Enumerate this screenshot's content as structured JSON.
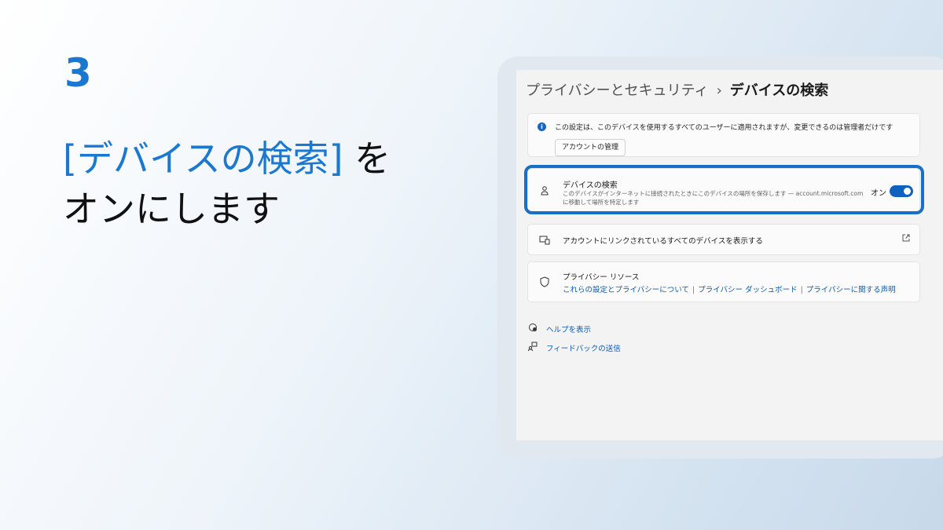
{
  "slide": {
    "step": "3",
    "headline_accent": "[デバイスの検索]",
    "headline_rest": " を",
    "headline_line2": "オンにします"
  },
  "settings": {
    "breadcrumb_parent": "プライバシーとセキュリティ",
    "breadcrumb_sep": "›",
    "breadcrumb_current": "デバイスの検索",
    "info_text": "この設定は、このデバイスを使用するすべてのユーザーに適用されますが、変更できるのは管理者だけです",
    "manage_account_label": "アカウントの管理",
    "find_device": {
      "title": "デバイスの検索",
      "description": "このデバイスがインターネットに接続されたときにこのデバイスの場所を保存します — account.microsoft.com に移動して場所を特定します",
      "toggle_label": "オン",
      "toggle_on": true
    },
    "linked_devices_label": "アカウントにリンクされているすべてのデバイスを表示する",
    "privacy_resources": {
      "title": "プライバシー リソース",
      "links": [
        "これらの設定とプライバシーについて",
        "プライバシー ダッシュボード",
        "プライバシーに関する声明"
      ],
      "separator": "|"
    },
    "help_label": "ヘルプを表示",
    "feedback_label": "フィードバックの送信"
  },
  "colors": {
    "accent": "#1a78d0",
    "highlight_border": "#1670c7",
    "toggle_on": "#1062c0",
    "link": "#0c5ab6"
  },
  "icons": {
    "info": "info-icon",
    "find_device": "person-pin-icon",
    "linked_devices": "devices-icon",
    "external": "external-link-icon",
    "privacy": "shield-icon",
    "help": "help-chat-icon",
    "feedback": "feedback-icon"
  }
}
